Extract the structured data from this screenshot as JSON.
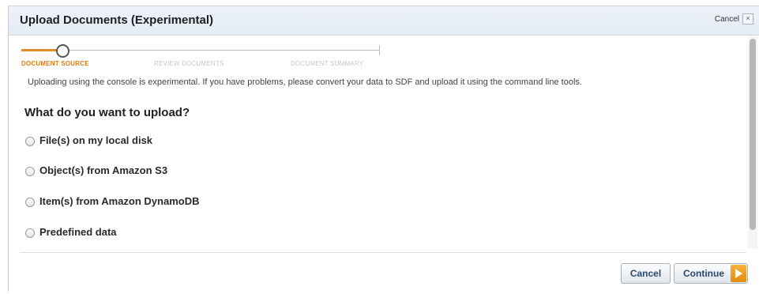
{
  "dialog": {
    "title": "Upload Documents (Experimental)",
    "cancel_link": "Cancel",
    "close_glyph": "×"
  },
  "steps": [
    {
      "label": "Document Source",
      "state": "active"
    },
    {
      "label": "Review Documents",
      "state": "pending"
    },
    {
      "label": "Document Summary",
      "state": "pending"
    }
  ],
  "notice": "Uploading using the console is experimental. If you have problems, please convert your data to SDF and upload it using the command line tools.",
  "question": "What do you want to upload?",
  "options": [
    {
      "label": "File(s) on my local disk",
      "selected": false
    },
    {
      "label": "Object(s) from Amazon S3",
      "selected": false
    },
    {
      "label": "Item(s) from Amazon DynamoDB",
      "selected": false
    },
    {
      "label": "Predefined data",
      "selected": false
    }
  ],
  "buttons": {
    "cancel": "Cancel",
    "continue": "Continue"
  },
  "colors": {
    "accent": "#e07c12",
    "titlebar": "#e3ebf5",
    "button_text": "#2b4a6b"
  },
  "icons": {
    "continue_arrow": "play-arrow-icon",
    "close": "close-icon"
  }
}
